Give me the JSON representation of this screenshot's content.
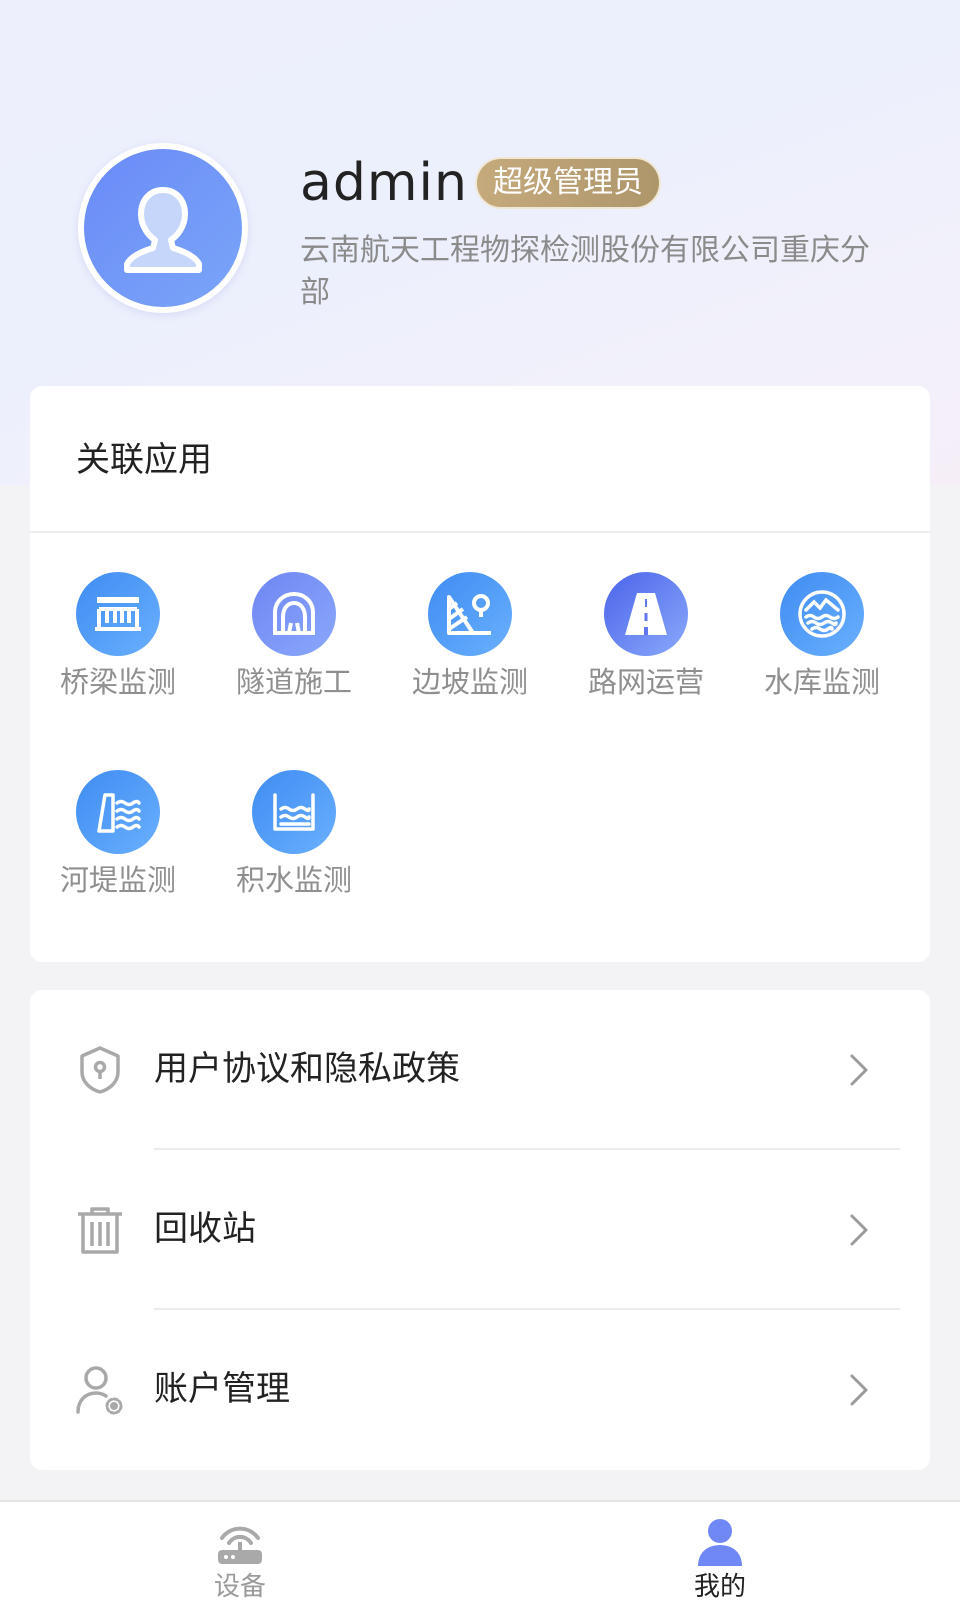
{
  "profile": {
    "username": "admin",
    "role": "超级管理员",
    "organization": "云南航天工程物探检测股份有限公司重庆分部"
  },
  "apps_section": {
    "title": "关联应用",
    "items": [
      {
        "label": "桥梁监测",
        "icon": "bridge-icon"
      },
      {
        "label": "隧道施工",
        "icon": "tunnel-icon"
      },
      {
        "label": "边坡监测",
        "icon": "slope-icon"
      },
      {
        "label": "路网运营",
        "icon": "road-icon"
      },
      {
        "label": "水库监测",
        "icon": "reservoir-icon"
      },
      {
        "label": "河堤监测",
        "icon": "levee-icon"
      },
      {
        "label": "积水监测",
        "icon": "waterlogging-icon"
      }
    ]
  },
  "menu": {
    "items": [
      {
        "label": "用户协议和隐私政策",
        "icon": "shield-icon"
      },
      {
        "label": "回收站",
        "icon": "trash-icon"
      },
      {
        "label": "账户管理",
        "icon": "user-settings-icon"
      }
    ]
  },
  "tabbar": {
    "items": [
      {
        "label": "设备",
        "icon": "router-icon",
        "active": false
      },
      {
        "label": "我的",
        "icon": "person-icon",
        "active": true
      }
    ]
  },
  "colors": {
    "accent": "#6a8af8",
    "badge": "#b89d70",
    "app_blue": "#3f8cf2"
  }
}
